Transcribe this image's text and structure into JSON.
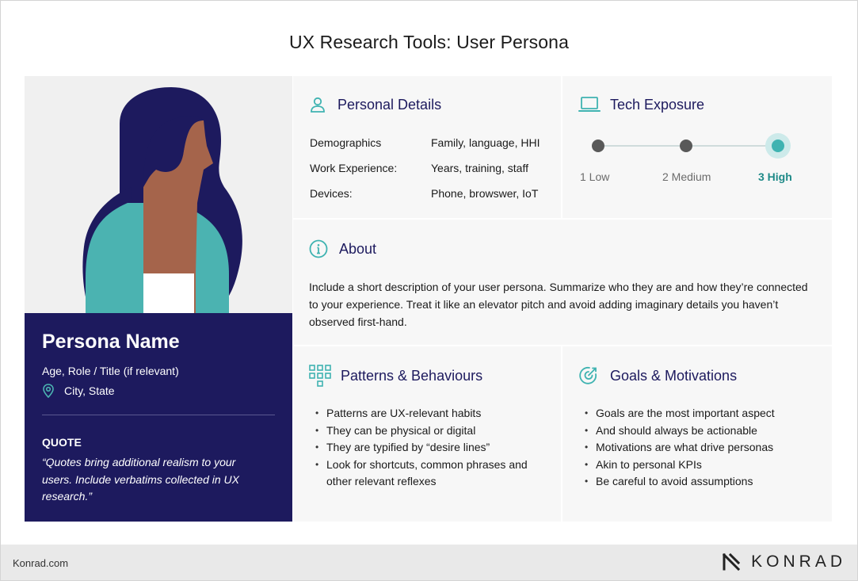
{
  "title": "UX Research Tools: User Persona",
  "persona": {
    "name": "Persona Name",
    "role": "Age, Role / Title (if relevant)",
    "location": "City, State",
    "quote_label": "QUOTE",
    "quote": "“Quotes bring additional realism to your users. Include verbatims collected in UX research.”"
  },
  "personal_details": {
    "heading": "Personal Details",
    "rows": [
      {
        "label": "Demographics",
        "value": "Family, language, HHI"
      },
      {
        "label": "Work Experience:",
        "value": "Years, training, staff"
      },
      {
        "label": "Devices:",
        "value": "Phone, browswer, IoT"
      }
    ]
  },
  "tech_exposure": {
    "heading": "Tech Exposure",
    "levels": [
      "1  Low",
      "2  Medium",
      "3  High"
    ],
    "selected_level": 3
  },
  "about": {
    "heading": "About",
    "text": "Include a short description of your user persona. Summarize who they are and how they’re connected to your experience. Treat it like an elevator pitch and avoid adding imaginary details you haven’t observed first-hand."
  },
  "patterns": {
    "heading": "Patterns & Behaviours",
    "items": [
      "Patterns are UX-relevant habits",
      "They can be physical or digital",
      "They are typified by “desire lines”",
      "Look for shortcuts, common phrases and other relevant reflexes"
    ]
  },
  "goals": {
    "heading": "Goals & Motivations",
    "items": [
      "Goals are the most important aspect",
      "And should always be actionable",
      "Motivations are what drive personas",
      "Akin to personal KPIs",
      "Be careful to avoid assumptions"
    ]
  },
  "footer": {
    "site": "Konrad.com",
    "brand": "KONRAD"
  },
  "colors": {
    "navy": "#1d1a5e",
    "teal": "#3fb3b1",
    "skin": "#a5644b",
    "panel": "#f7f7f7"
  },
  "icons": [
    "person-icon",
    "laptop-icon",
    "info-icon",
    "grid-icon",
    "target-icon",
    "location-pin-icon",
    "konrad-logo-icon"
  ]
}
